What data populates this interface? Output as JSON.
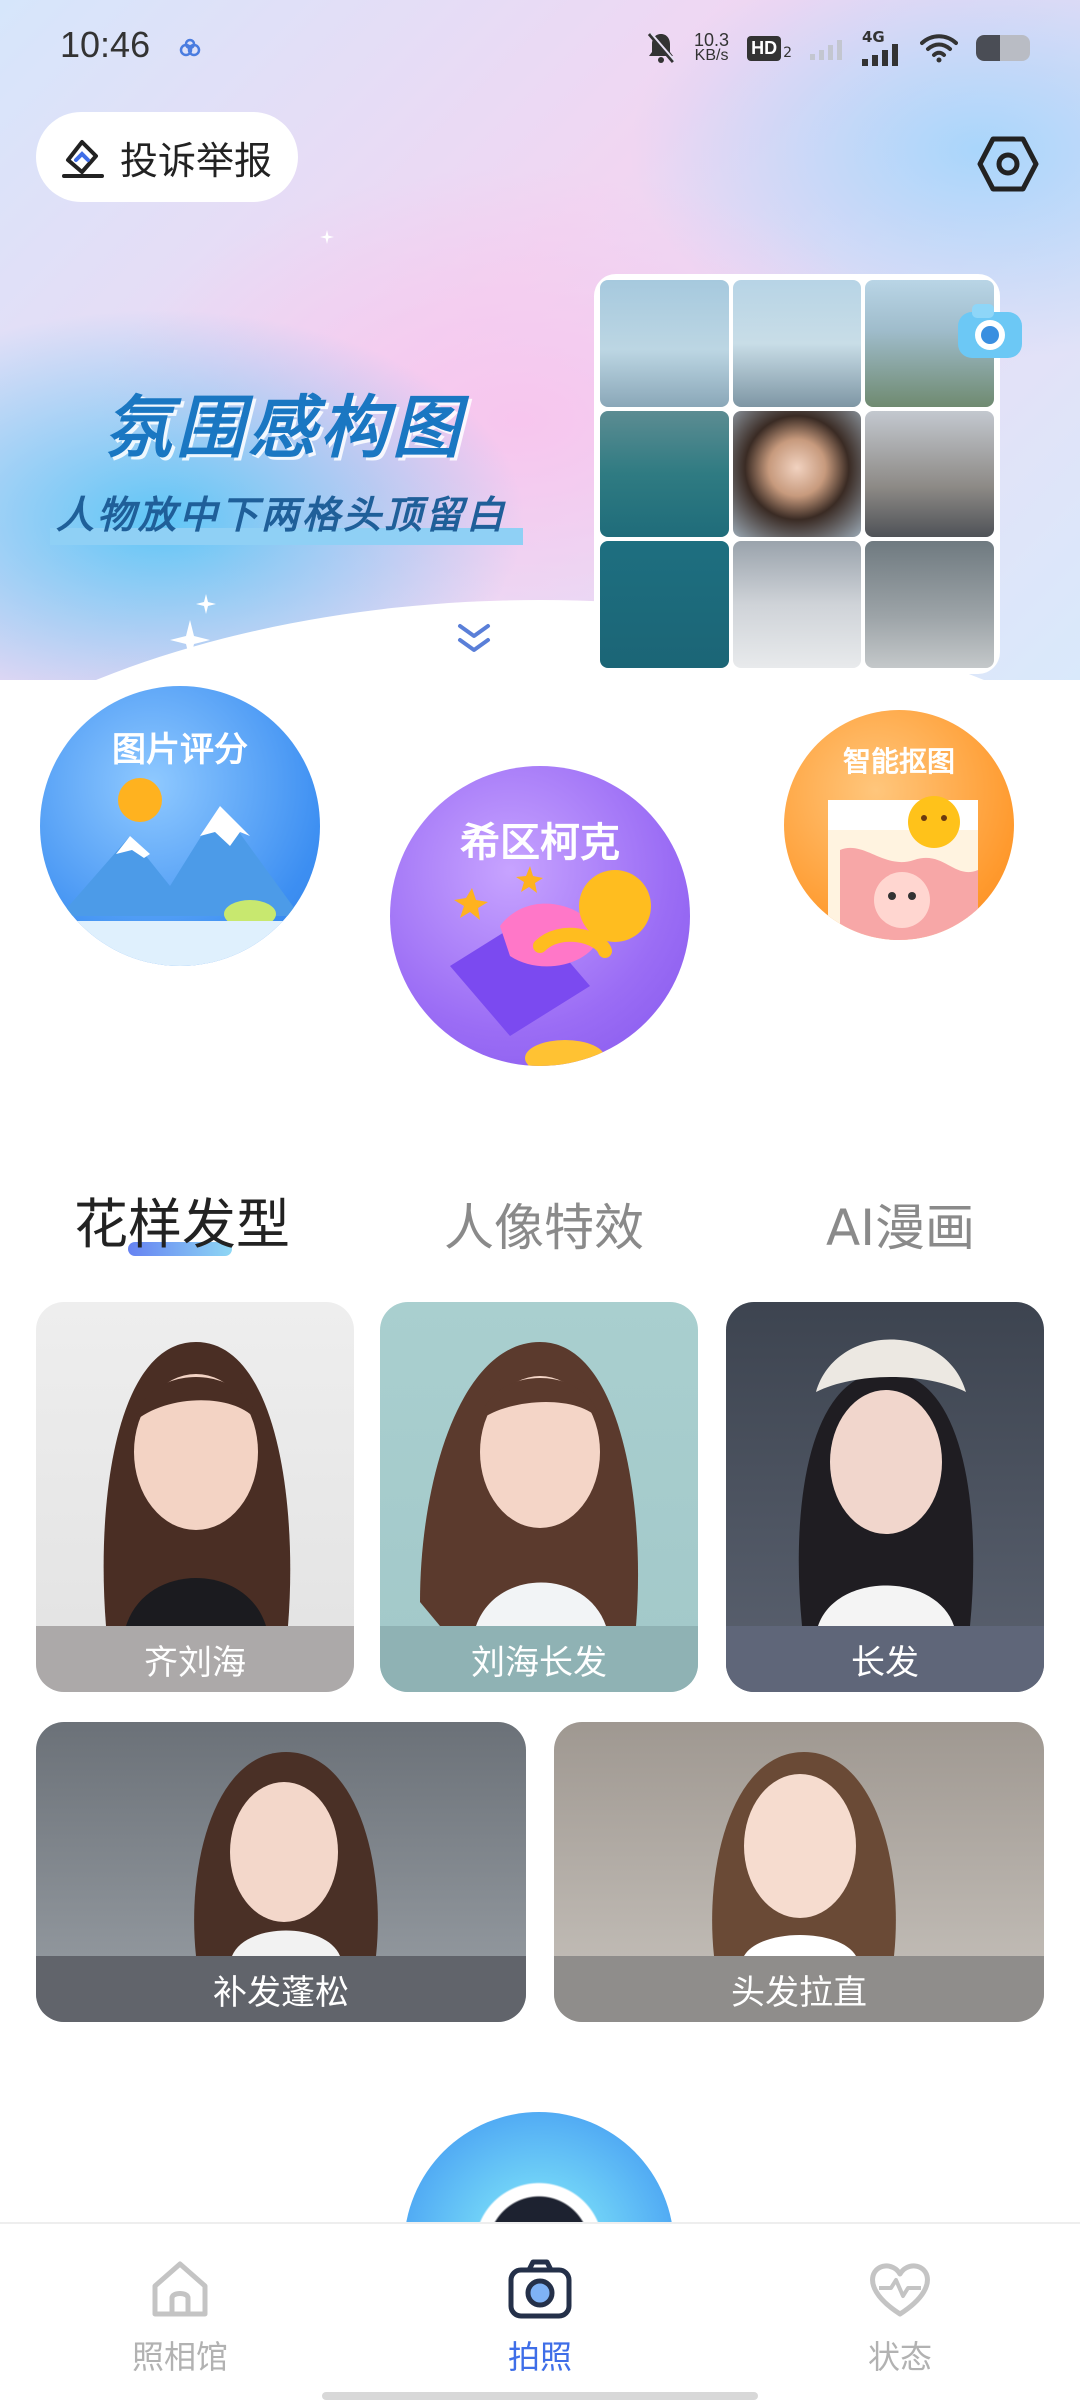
{
  "status_bar": {
    "time": "10:46",
    "net_speed_value": "10.3",
    "net_speed_unit": "KB/s",
    "hd_badge": "HD",
    "hd_sub": "2",
    "network_type": "4G",
    "battery_level": 0.45
  },
  "header": {
    "report_label": "投诉举报"
  },
  "banner": {
    "title": "氛围感构图",
    "subtitle": "人物放中下两格头顶留白"
  },
  "features": [
    {
      "label": "图片评分"
    },
    {
      "label": "希区柯克"
    },
    {
      "label": "智能抠图"
    }
  ],
  "tabs": [
    {
      "label": "花样发型",
      "active": true
    },
    {
      "label": "人像特效",
      "active": false
    },
    {
      "label": "AI漫画",
      "active": false
    }
  ],
  "styles": [
    {
      "label": "齐刘海"
    },
    {
      "label": "刘海长发"
    },
    {
      "label": "长发"
    },
    {
      "label": "补发蓬松"
    },
    {
      "label": "头发拉直"
    }
  ],
  "bottom_nav": [
    {
      "label": "照相馆",
      "icon": "house-icon",
      "active": false
    },
    {
      "label": "拍照",
      "icon": "camera-icon",
      "active": true
    },
    {
      "label": "状态",
      "icon": "heart-pulse-icon",
      "active": false
    }
  ],
  "colors": {
    "accent": "#3f6ee8",
    "title_blue": "#1a77c2",
    "inactive": "#b2b2b2"
  }
}
